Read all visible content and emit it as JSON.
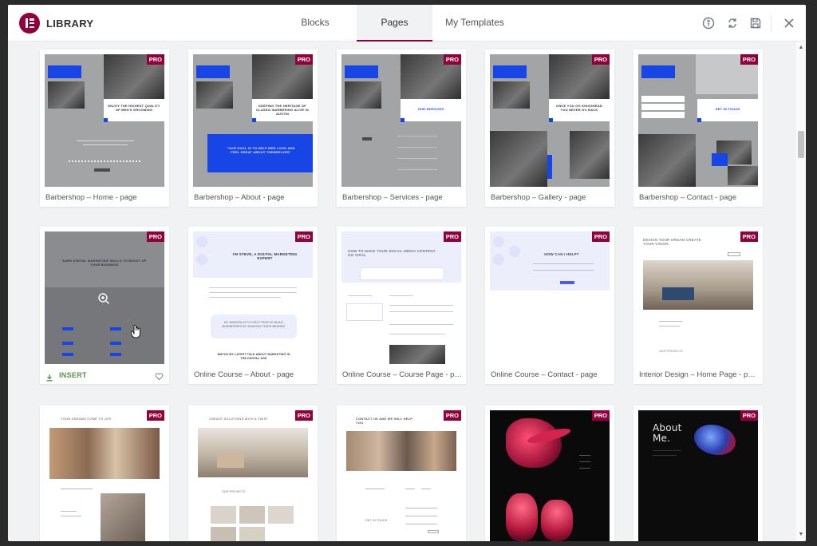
{
  "header": {
    "title": "LIBRARY",
    "tabs": [
      {
        "label": "Blocks",
        "active": false
      },
      {
        "label": "Pages",
        "active": true
      },
      {
        "label": "My Templates",
        "active": false
      }
    ],
    "icons": [
      "info-icon",
      "sync-icon",
      "save-icon",
      "close-icon"
    ]
  },
  "colors": {
    "accent": "#92003b",
    "badge_bg": "#92003b",
    "preview_blue": "#1745e6"
  },
  "badge_label": "PRO",
  "insert_label": "INSERT",
  "cards": [
    {
      "name": "Barbershop – Home - page",
      "pro": true
    },
    {
      "name": "Barbershop – About - page",
      "pro": true
    },
    {
      "name": "Barbershop – Services - page",
      "pro": true
    },
    {
      "name": "Barbershop – Gallery - page",
      "pro": true
    },
    {
      "name": "Barbershop – Contact - page",
      "pro": true
    },
    {
      "name": "",
      "pro": true,
      "hovered": true
    },
    {
      "name": "Online Course – About - page",
      "pro": true
    },
    {
      "name": "Online Course – Course Page - page",
      "pro": true
    },
    {
      "name": "Online Course – Contact - page",
      "pro": true
    },
    {
      "name": "Interior Design – Home Page - page",
      "pro": true
    },
    {
      "name": "",
      "pro": true
    },
    {
      "name": "",
      "pro": true
    },
    {
      "name": "",
      "pro": true
    },
    {
      "name": "",
      "pro": true
    },
    {
      "name": "",
      "pro": true
    }
  ],
  "previews": {
    "barber_home": "ENJOY THE HIGHEST QUALITY OF MEN'S GROOMING",
    "barber_about_head": "KEEPING THE HERITAGE OF CLASSIC BARBERING ALIVE IN AUSTIN",
    "barber_about_quote": "\"OUR GOAL IS TO HELP MEN LOOK AND FEEL GREAT ABOUT THEMSELVES\"",
    "barber_services": "OUR SERVICES",
    "barber_gallery": "ONCE YOU GO KINGSHEAD YOU NEVER GO BACK",
    "barber_contact": "GET IN TOUCH",
    "marketing": "EARN DIGITAL MARKETING SKILLS TO BOOST UP YOUR BUSINESS",
    "course_about": "I'M STEVE, A DIGITAL MARKETING EXPERT",
    "course_about_block": "MY MISSION IS TO HELP PEOPLE BUILD BUSINESSES BY SHARING THEIR BRANDS",
    "course_about_foot": "WATCH MY LATEST TALK ABOUT MARKETING IN THE DIGITAL AGE",
    "course_page": "HOW TO MAKE YOUR SOCIAL MEDIA CONTENT GO VIRAL",
    "course_contact": "HOW CAN I HELP?",
    "interior": "DESIGN YOUR DREAM CREATE YOUR VISION.",
    "interior_projects": "OUR PROJECTS",
    "dreams": "YOUR DREAMS COME TO LIFE",
    "solutions": "CREATE SOLUTIONS WITH A TWIST",
    "solutions_projects": "OUR PROJECTS",
    "contact_we": "CONTACT US AND WE WILL HELP YOU",
    "contact_touch": "GET IN TOUCH",
    "about_me": "About Me."
  }
}
